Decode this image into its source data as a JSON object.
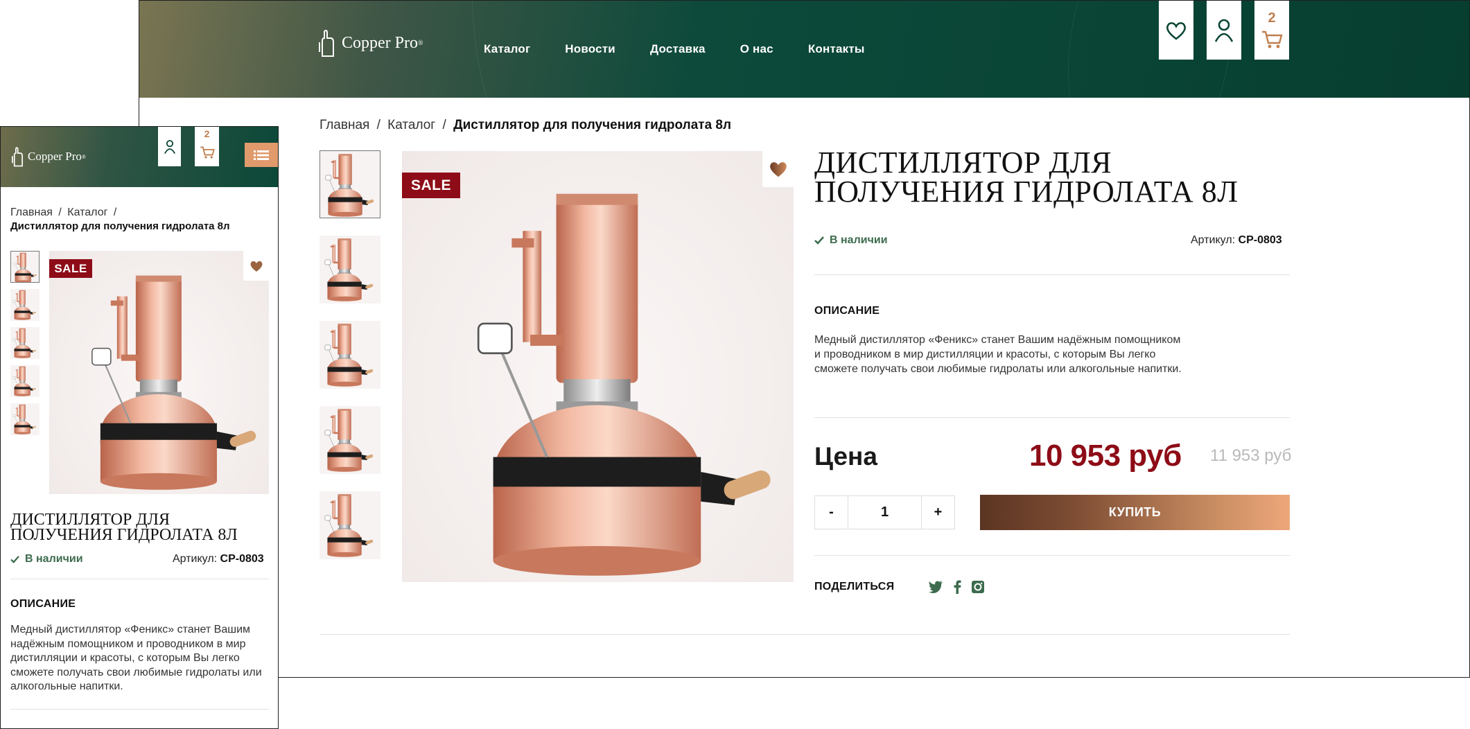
{
  "desktop": {
    "logo": {
      "text": "Copper Pro",
      "reg": "®"
    },
    "nav": [
      "Каталог",
      "Новости",
      "Доставка",
      "О нас",
      "Контакты"
    ],
    "header_buttons": {
      "favorites_icon": "heart-icon",
      "account_icon": "user-icon",
      "cart_icon": "cart-icon",
      "cart_count": "2"
    },
    "breadcrumb": {
      "home": "Главная",
      "sep": "/",
      "catalog": "Каталог",
      "current": "Дистиллятор для получения гидролата 8л"
    },
    "badge": "SALE",
    "product": {
      "title": "Дистиллятор для получения гидролата 8л",
      "stock": "В наличии",
      "sku_label": "Артикул:",
      "sku": "CP-0803",
      "desc_label": "ОПИСАНИЕ",
      "description": "Медный дистиллятор «Феникс» станет Вашим надёжным помощником и проводником в мир дистилляции и красоты, с которым Вы легко сможете получать свои любимые гидролаты или алкогольные напитки.",
      "price_label": "Цена",
      "price": "10 953 руб",
      "old_price": "11 953 руб",
      "qty_minus": "-",
      "qty_value": "1",
      "qty_plus": "+",
      "buy": "КУПИТЬ",
      "share": "ПОДЕЛИТЬСЯ",
      "socials": [
        "twitter-icon",
        "facebook-icon",
        "instagram-icon"
      ]
    }
  },
  "mobile": {
    "logo": {
      "text": "Copper Pro",
      "reg": "®"
    },
    "cart_count": "2",
    "breadcrumb": {
      "home": "Главная",
      "sep": "/",
      "catalog": "Каталог",
      "sep2": "/",
      "current": "Дистиллятор для получения гидролата 8л"
    },
    "badge": "SALE",
    "product": {
      "title": "Дистиллятор для получения гидролата 8л",
      "stock": "В наличии",
      "sku_label": "Артикул:",
      "sku": "CP-0803",
      "desc_label": "ОПИСАНИЕ",
      "description": "Медный дистиллятор «Феникс» станет Вашим надёжным помощником и проводником в мир дистилляции и красоты, с которым Вы легко сможете получать свои любимые гидролаты или алкогольные напитки."
    }
  },
  "colors": {
    "header_green": "#0a4535",
    "sale_red": "#8d0c17",
    "price_red": "#8d0c17",
    "stock_green": "#3c6b4d",
    "copper": "#c07f4f"
  }
}
